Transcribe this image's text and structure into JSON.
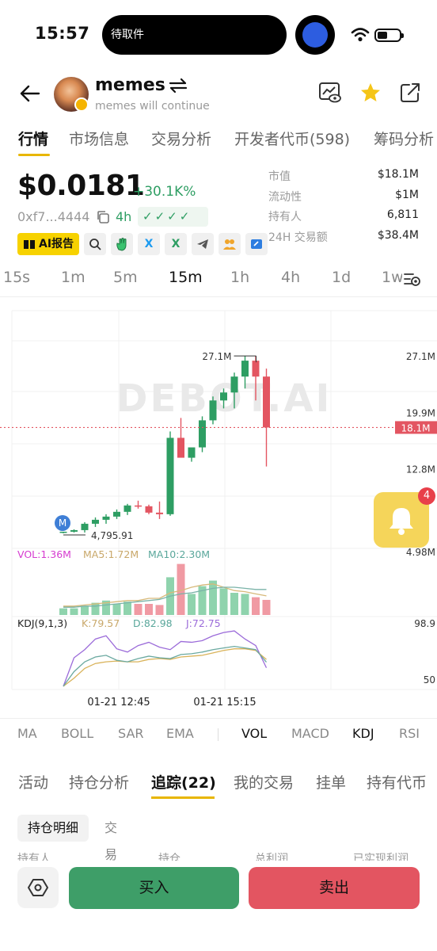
{
  "status_bar": {
    "time": "15:57",
    "island_text": "待取件"
  },
  "header": {
    "token_name": "memes",
    "token_desc": "memes will continue"
  },
  "tabs": [
    "行情",
    "市场信息",
    "交易分析",
    "开发者代币(598)",
    "筹码分析"
  ],
  "price": {
    "value": "$0.0181",
    "change": "+30.1K%",
    "address": "0xf7...4444",
    "age": "4h",
    "checks": "✓✓✓✓"
  },
  "stats": [
    {
      "label": "市值",
      "value": "$18.1M"
    },
    {
      "label": "流动性",
      "value": "$1M"
    },
    {
      "label": "持有人",
      "value": "6,811"
    },
    {
      "label": "24H 交易额",
      "value": "$38.4M"
    }
  ],
  "ai_report": "AI报告",
  "intervals": [
    "15s",
    "1m",
    "5m",
    "15m",
    "1h",
    "4h",
    "1d",
    "1w"
  ],
  "chart_data": {
    "type": "candlestick",
    "watermark": "DEBOT.AI",
    "price_axis_labels": [
      "27.1M",
      "19.9M",
      "12.8M",
      "4.98M"
    ],
    "current_price_label": "18.1M",
    "high_marker": "27.1M",
    "low_marker": "4,795.91",
    "low_marker_badge": "M",
    "candles": [
      {
        "o": 4.9,
        "h": 5.0,
        "l": 4.8,
        "c": 5.0
      },
      {
        "o": 5.0,
        "h": 5.3,
        "l": 4.9,
        "c": 5.2
      },
      {
        "o": 5.2,
        "h": 6.2,
        "l": 4.9,
        "c": 6.0
      },
      {
        "o": 6.0,
        "h": 6.8,
        "l": 5.6,
        "c": 6.5
      },
      {
        "o": 6.5,
        "h": 7.2,
        "l": 6.0,
        "c": 6.9
      },
      {
        "o": 6.9,
        "h": 7.8,
        "l": 6.6,
        "c": 7.5
      },
      {
        "o": 7.5,
        "h": 8.5,
        "l": 7.1,
        "c": 8.3
      },
      {
        "o": 8.3,
        "h": 8.9,
        "l": 7.9,
        "c": 8.2
      },
      {
        "o": 8.2,
        "h": 8.4,
        "l": 7.2,
        "c": 7.4
      },
      {
        "o": 7.4,
        "h": 8.8,
        "l": 6.6,
        "c": 7.2
      },
      {
        "o": 7.2,
        "h": 17.6,
        "l": 7.0,
        "c": 16.8
      },
      {
        "o": 16.8,
        "h": 19.3,
        "l": 14.9,
        "c": 14.3
      },
      {
        "o": 14.3,
        "h": 15.5,
        "l": 13.8,
        "c": 15.6
      },
      {
        "o": 15.6,
        "h": 19.5,
        "l": 15.0,
        "c": 19.0
      },
      {
        "o": 19.0,
        "h": 22.0,
        "l": 18.5,
        "c": 21.5
      },
      {
        "o": 21.5,
        "h": 23.0,
        "l": 20.5,
        "c": 22.5
      },
      {
        "o": 22.5,
        "h": 25.0,
        "l": 20.5,
        "c": 24.5
      },
      {
        "o": 24.5,
        "h": 27.1,
        "l": 23.0,
        "c": 26.5
      },
      {
        "o": 26.5,
        "h": 27.1,
        "l": 21.5,
        "c": 24.5
      },
      {
        "o": 24.5,
        "h": 25.5,
        "l": 13.2,
        "c": 18.1
      }
    ],
    "y_range": [
      3.5,
      29.0
    ],
    "vol": {
      "label": "VOL:1.36M",
      "ma5": "MA5:1.72M",
      "ma10": "MA10:2.30M",
      "values": [
        0.6,
        0.6,
        0.8,
        1.1,
        1.3,
        1.0,
        1.2,
        1.0,
        1.0,
        0.9,
        3.4,
        4.6,
        1.9,
        2.6,
        3.1,
        2.4,
        2.0,
        1.9,
        1.6,
        1.36
      ],
      "ma5_values": [
        0.8,
        0.8,
        0.9,
        1.0,
        1.1,
        1.2,
        1.3,
        1.3,
        1.5,
        1.5,
        2.0,
        2.2,
        2.5,
        2.7,
        2.8,
        2.5,
        2.2,
        2.1,
        1.9,
        1.72
      ],
      "ma10_values": [
        0.7,
        0.7,
        0.8,
        0.8,
        0.9,
        1.0,
        1.1,
        1.2,
        1.3,
        1.4,
        1.7,
        1.9,
        2.0,
        2.2,
        2.4,
        2.5,
        2.5,
        2.4,
        2.3,
        2.3
      ],
      "y_max": 5.0
    },
    "kdj": {
      "label": "KDJ(9,1,3)",
      "k": "K:79.57",
      "d": "D:82.98",
      "j": "J:72.75",
      "k_values": [
        50,
        68,
        80,
        86,
        88,
        82,
        80,
        84,
        87,
        85,
        84,
        89,
        90,
        92,
        95,
        97,
        99,
        97,
        95,
        79.57
      ],
      "d_values": [
        50,
        60,
        72,
        78,
        80,
        81,
        80,
        80,
        83,
        84,
        83,
        86,
        87,
        88,
        91,
        94,
        96,
        96,
        94,
        82.98
      ],
      "j_values": [
        50,
        85,
        95,
        108,
        112,
        96,
        92,
        100,
        104,
        98,
        95,
        105,
        104,
        106,
        112,
        116,
        118,
        108,
        100,
        72.75
      ],
      "axis_labels": [
        "98.9",
        "50"
      ],
      "y_range": [
        50,
        120
      ]
    },
    "x_labels": [
      "01-21 12:45",
      "01-21 15:15"
    ]
  },
  "indicators": [
    "MA",
    "BOLL",
    "SAR",
    "EMA",
    "VOL",
    "MACD",
    "KDJ",
    "RSI"
  ],
  "bell_badge": "4",
  "tabs2": [
    "活动",
    "持仓分析",
    "追踪(22)",
    "我的交易",
    "挂单",
    "持有代币"
  ],
  "subtabs": {
    "hold": "持仓明细",
    "trade": "交易明细"
  },
  "table_head": [
    "持有人",
    "持仓",
    "总利润",
    "已实现利润"
  ],
  "actions": {
    "buy": "买入",
    "sell": "卖出"
  },
  "colors": {
    "up": "#2e9e63",
    "down": "#e35561",
    "accent": "#e8b600",
    "bell": "#f5d55a"
  }
}
